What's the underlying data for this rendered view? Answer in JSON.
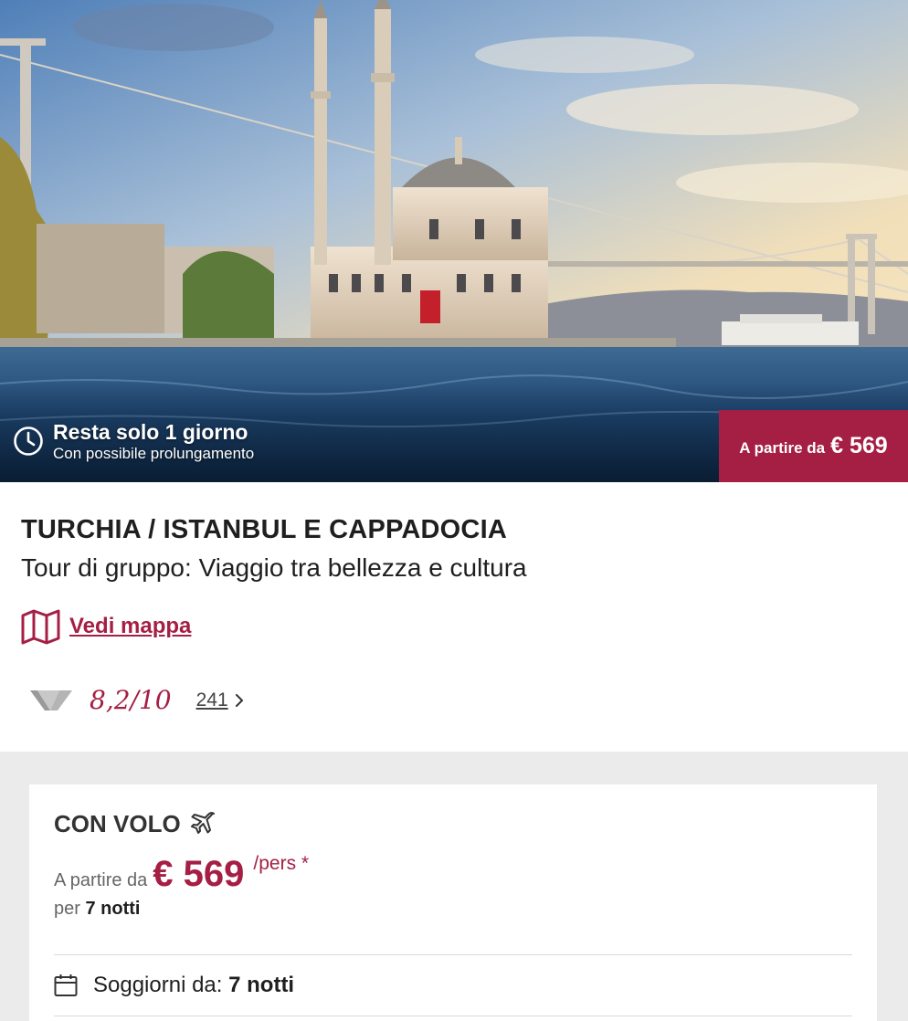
{
  "hero": {
    "urgency_title": "Resta solo 1 giorno",
    "urgency_subtitle": "Con possibile prolungamento",
    "price_label": "A partire da",
    "price_value": "€ 569",
    "accent_color": "#a51f44"
  },
  "product": {
    "title": "TURCHIA / ISTANBUL E CAPPADOCIA",
    "subtitle": "Tour di gruppo: Viaggio tra bellezza e cultura",
    "map_link_label": "Vedi mappa"
  },
  "rating": {
    "score": "8,2/10",
    "review_count": "241"
  },
  "offer": {
    "heading": "CON VOLO",
    "from_label": "A partire da",
    "price": "€ 569",
    "per_person": "/pers *",
    "duration_prefix": "per",
    "duration_value": "7 notti",
    "stay_label": "Soggiorni da:",
    "stay_value": "7 notti"
  },
  "icons": {
    "clock": "clock-icon",
    "map": "map-icon",
    "plane": "airplane-icon",
    "calendar": "calendar-icon",
    "chevron": "chevron-right-icon",
    "logo": "brand-logo-icon"
  }
}
